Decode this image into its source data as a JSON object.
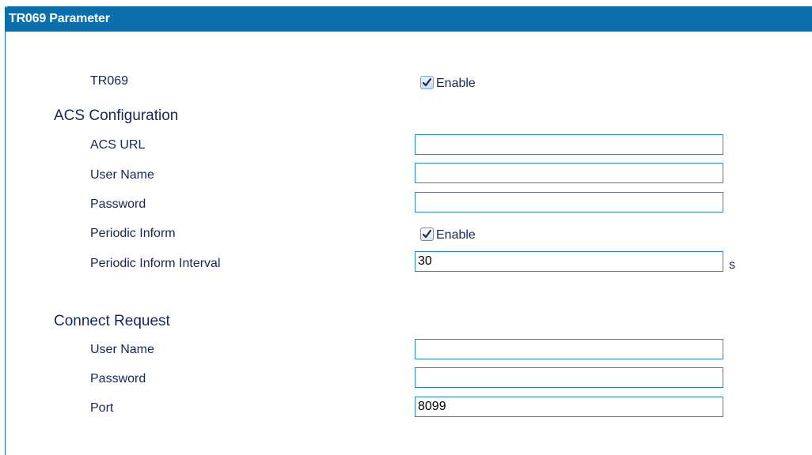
{
  "header": {
    "title": "TR069 Parameter"
  },
  "tr069": {
    "label": "TR069",
    "checked": true,
    "checkbox_label": "Enable"
  },
  "acs": {
    "section_title": "ACS Configuration",
    "url_label": "ACS URL",
    "url_value": "",
    "username_label": "User Name",
    "username_value": "",
    "password_label": "Password",
    "password_value": "",
    "periodic_label": "Periodic Inform",
    "periodic_checked": true,
    "periodic_checkbox_label": "Enable",
    "interval_label": "Periodic Inform Interval",
    "interval_value": "30",
    "interval_unit": "s"
  },
  "connect": {
    "section_title": "Connect Request",
    "username_label": "User Name",
    "username_value": "",
    "password_label": "Password",
    "password_value": "",
    "port_label": "Port",
    "port_value": "8099"
  },
  "colors": {
    "header_bg": "#0b6fae",
    "input_border": "#2e86c1",
    "label_text": "#16255a"
  },
  "icons": {
    "checkbox_checked": "checkmark-icon"
  }
}
